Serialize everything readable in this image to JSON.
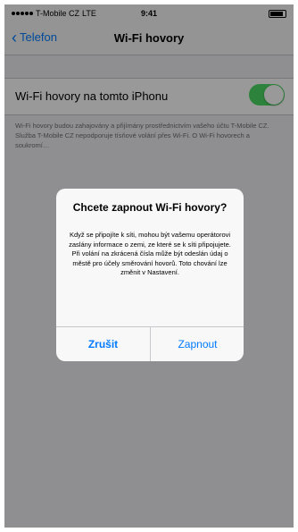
{
  "status_bar": {
    "carrier": "T-Mobile CZ",
    "network": "LTE",
    "time": "9:41"
  },
  "nav": {
    "back_label": "Telefon",
    "title": "Wi-Fi hovory"
  },
  "settings": {
    "toggle_label": "Wi-Fi hovory na tomto iPhonu",
    "toggle_on": true,
    "footer_text": "Wi-Fi hovory budou zahajovány a přijímány prostřednictvím vašeho účtu T-Mobile CZ. Služba T-Mobile CZ nepodporuje tísňové volání přes Wi-Fi. O Wi-Fi hovorech a soukromí…"
  },
  "alert": {
    "title": "Chcete zapnout Wi-Fi hovory?",
    "message": "Když se připojíte k síti, mohou být vašemu operátorovi zaslány informace o zemi, ze které se k síti připojujete. Při volání na zkrácená čísla může být odeslán údaj o městě pro účely směrování hovorů. Toto chování lze změnit v Nastavení.",
    "cancel_label": "Zrušit",
    "confirm_label": "Zapnout"
  },
  "colors": {
    "accent": "#007aff",
    "toggle_on": "#4cd964",
    "background": "#efeff4"
  }
}
